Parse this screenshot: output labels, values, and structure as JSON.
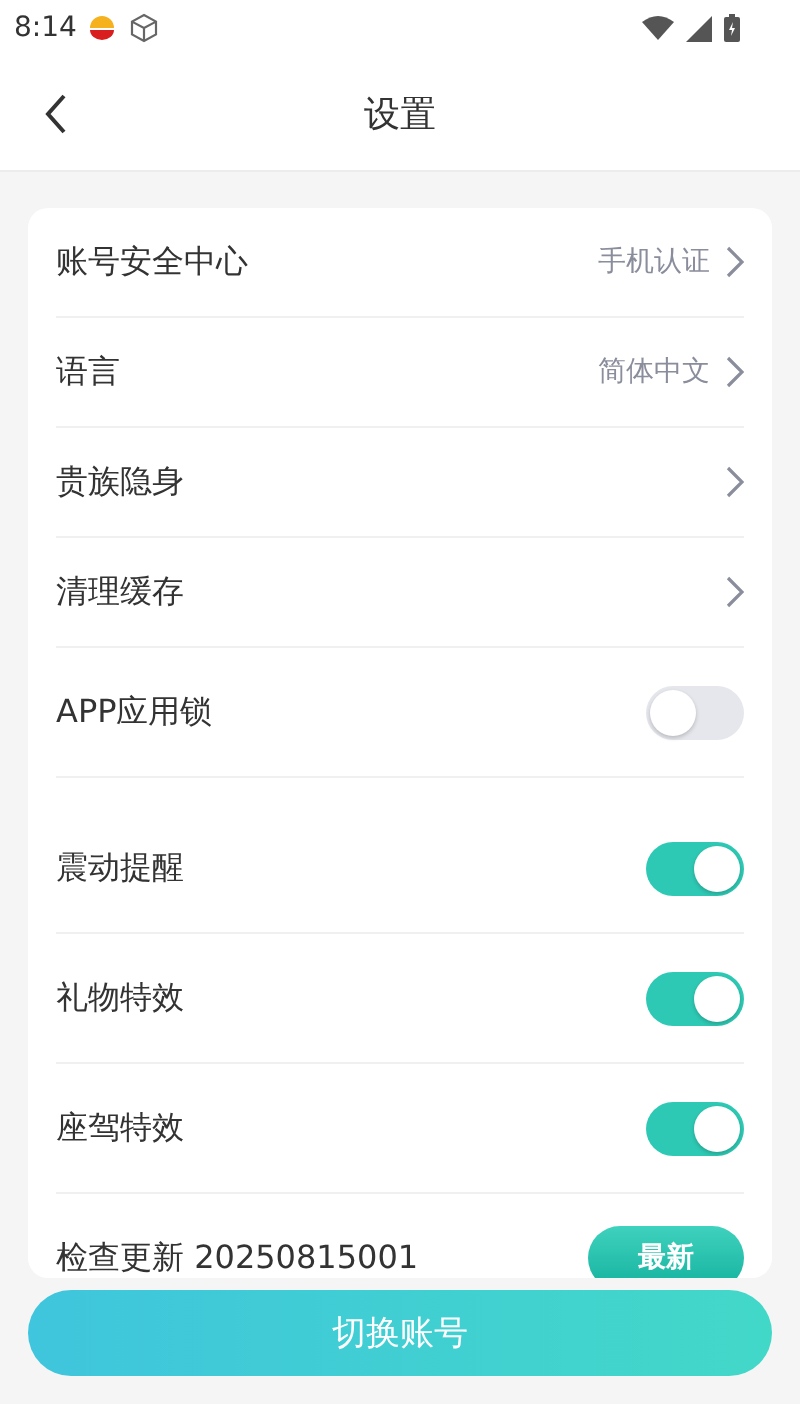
{
  "status_bar": {
    "time": "8:14"
  },
  "header": {
    "title": "设置"
  },
  "sections": [
    {
      "rows": [
        {
          "kind": "nav",
          "label": "账号安全中心",
          "value": "手机认证"
        },
        {
          "kind": "nav",
          "label": "语言",
          "value": "简体中文"
        },
        {
          "kind": "nav",
          "label": "贵族隐身"
        },
        {
          "kind": "nav",
          "label": "清理缓存"
        },
        {
          "kind": "toggle",
          "label": "APP应用锁",
          "on": false
        }
      ]
    },
    {
      "rows": [
        {
          "kind": "toggle",
          "label": "震动提醒",
          "on": true
        },
        {
          "kind": "toggle",
          "label": "礼物特效",
          "on": true
        },
        {
          "kind": "toggle",
          "label": "座驾特效",
          "on": true
        },
        {
          "kind": "update",
          "label": "检查更新 20250815001",
          "badge": "最新"
        }
      ]
    }
  ],
  "bottom_button": {
    "label": "切换账号"
  }
}
